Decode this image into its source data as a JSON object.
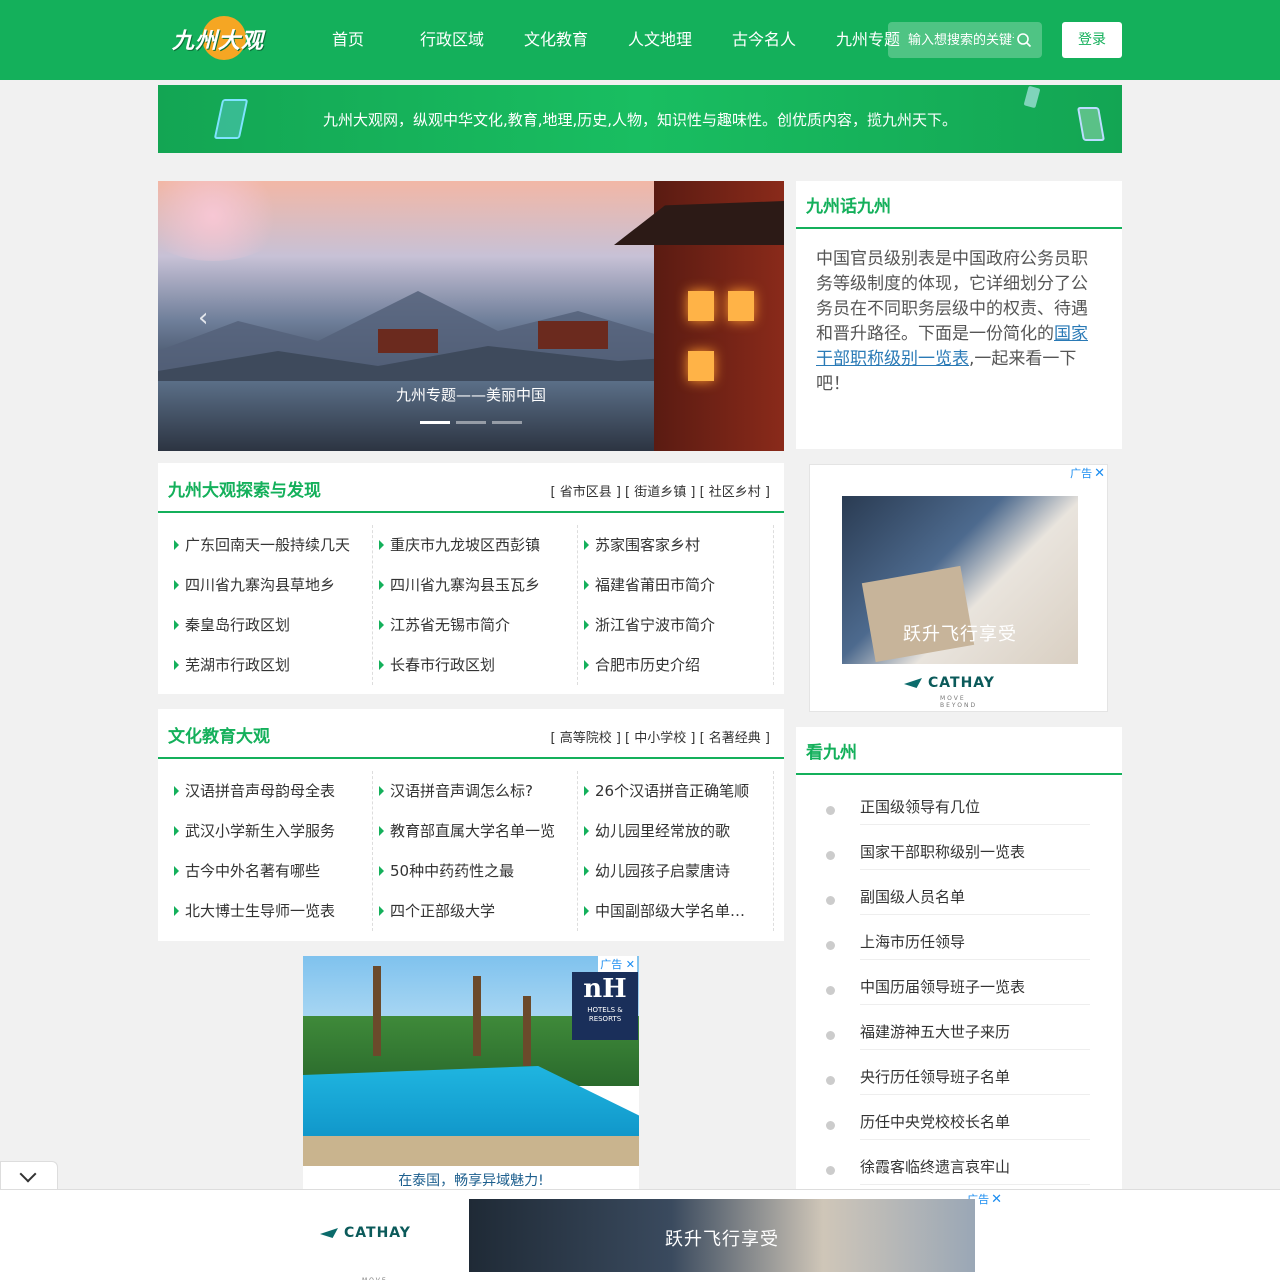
{
  "header": {
    "logo_text": "九州大观",
    "nav": [
      "首页",
      "行政区域",
      "文化教育",
      "人文地理",
      "古今名人",
      "九州专题"
    ],
    "search_placeholder": "输入想搜索的关键词",
    "login_label": "登录",
    "brand_color": "#14b05b"
  },
  "banner": {
    "text": "九州大观网，纵观中华文化,教育,地理,历史,人物，知识性与趣味性。创优质内容，揽九州天下。"
  },
  "slider": {
    "caption": "九州专题——美丽中国",
    "prev_icon": "chevron-left-icon",
    "slides_total": 3,
    "active_slide": 1
  },
  "intro": {
    "title": "九州话九州",
    "text_before": "中国官员级别表是中国政府公务员职务等级制度的体现，它详细划分了公务员在不同职务层级中的权责、待遇和晋升路径。下面是一份简化的",
    "link": "国家干部职称级别一览表",
    "text_after": ",一起来看一下吧！"
  },
  "ads": {
    "tag": "广告",
    "close": "✕",
    "cathay_brand": "CATHAY",
    "cathay_sub": "MOVE BEYOND",
    "cathay_slogan": "跃升飞行享受",
    "nh_big": "nH",
    "nh_small1": "HOTELS &",
    "nh_small2": "RESORTS",
    "nh_slogan": "在泰国，畅享异域魅力!"
  },
  "explore": {
    "title": "九州大观探索与发现",
    "links": "[ 省市区县 ] [ 街道乡镇 ] [ 社区乡村 ]",
    "columns": [
      [
        "广东回南天一般持续几天",
        "四川省九寨沟县草地乡",
        "秦皇岛行政区划",
        "芜湖市行政区划"
      ],
      [
        "重庆市九龙坡区西彭镇",
        "四川省九寨沟县玉瓦乡",
        "江苏省无锡市简介",
        "长春市行政区划"
      ],
      [
        "苏家围客家乡村",
        "福建省莆田市简介",
        "浙江省宁波市简介",
        "合肥市历史介绍"
      ]
    ]
  },
  "culture": {
    "title": "文化教育大观",
    "links": "[ 高等院校 ] [ 中小学校 ] [ 名著经典 ]",
    "columns": [
      [
        "汉语拼音声母韵母全表",
        "武汉小学新生入学服务",
        "古今中外名著有哪些",
        "北大博士生导师一览表"
      ],
      [
        "汉语拼音声调怎么标?",
        "教育部直属大学名单一览",
        "50种中药药性之最",
        "四个正部级大学"
      ],
      [
        "26个汉语拼音正确笔顺",
        "幼儿园里经常放的歌",
        "幼儿园孩子启蒙唐诗",
        "中国副部级大学名单一览"
      ]
    ]
  },
  "kan": {
    "title": "看九州",
    "items": [
      "正国级领导有几位",
      "国家干部职称级别一览表",
      "副国级人员名单",
      "上海市历任领导",
      "中国历届领导班子一览表",
      "福建游神五大世子来历",
      "央行历任领导班子名单",
      "历任中央党校校长名单",
      "徐霞客临终遗言哀牢山"
    ]
  }
}
